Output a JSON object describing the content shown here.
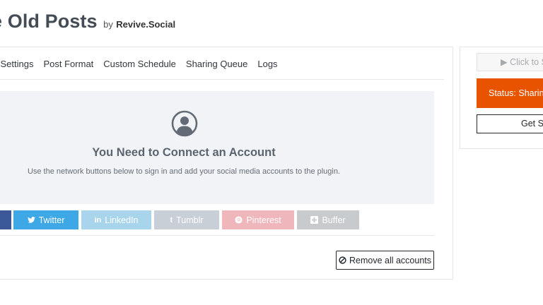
{
  "header": {
    "title": "e Old Posts",
    "by_text": "by",
    "brand": "Revive.Social"
  },
  "tabs": [
    {
      "label": "l Settings"
    },
    {
      "label": "Post Format"
    },
    {
      "label": "Custom Schedule"
    },
    {
      "label": "Sharing Queue"
    },
    {
      "label": "Logs"
    }
  ],
  "connect_panel": {
    "heading": "You Need to Connect an Account",
    "text": "Use the network buttons below to sign in and add your social media accounts to the plugin."
  },
  "networks": {
    "twitter": "Twitter",
    "linkedin": "LinkedIn",
    "tumblr": "Tumblr",
    "pinterest": "Pinterest",
    "buffer": "Buffer"
  },
  "remove_label": "Remove all accounts",
  "sidebar": {
    "start_label": "Click to S",
    "status_label": "Status: Sharin",
    "support_label": "Get S"
  },
  "colors": {
    "facebook": "#3b5998",
    "twitter": "#3ea7e5",
    "linkedin": "#a8d5ec",
    "tumblr": "#c9cfd6",
    "pinterest": "#efb6bb",
    "buffer": "#c8cbce",
    "status": "#e85300"
  }
}
